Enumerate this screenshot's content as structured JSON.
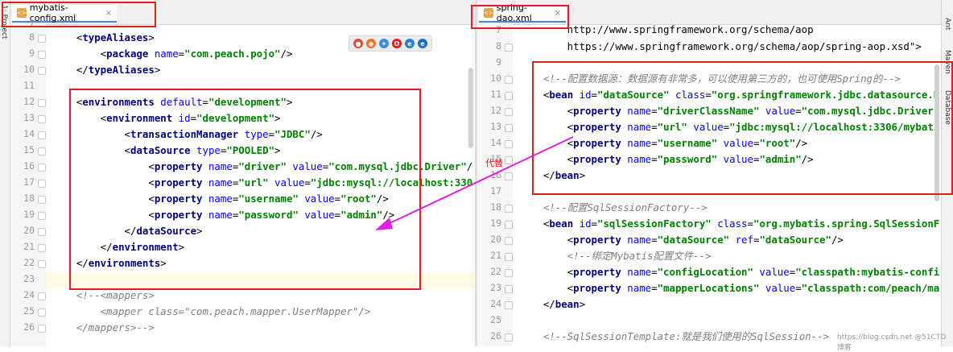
{
  "left_panel": {
    "label": "1: Project"
  },
  "right_panel": {
    "labels": [
      "Ant",
      "Maven",
      "Database"
    ]
  },
  "left_editor": {
    "tab": {
      "label": "mybatis-config.xml",
      "close": "×"
    },
    "first_line": "7",
    "lines": [
      {
        "n": "8",
        "segs": [
          {
            "k": "p",
            "x": "    <"
          },
          {
            "k": "t",
            "x": "typeAliases"
          },
          {
            "k": "p",
            "x": ">"
          }
        ]
      },
      {
        "n": "9",
        "segs": [
          {
            "k": "p",
            "x": "        <"
          },
          {
            "k": "t",
            "x": "package "
          },
          {
            "k": "a",
            "x": "name"
          },
          {
            "k": "p",
            "x": "="
          },
          {
            "k": "v",
            "x": "\"com.peach.pojo\""
          },
          {
            "k": "p",
            "x": "/>"
          }
        ]
      },
      {
        "n": "10",
        "segs": [
          {
            "k": "p",
            "x": "    </"
          },
          {
            "k": "t",
            "x": "typeAliases"
          },
          {
            "k": "p",
            "x": ">"
          }
        ]
      },
      {
        "n": "11",
        "segs": []
      },
      {
        "n": "12",
        "segs": [
          {
            "k": "p",
            "x": "    <"
          },
          {
            "k": "t",
            "x": "environments "
          },
          {
            "k": "a",
            "x": "default"
          },
          {
            "k": "p",
            "x": "="
          },
          {
            "k": "v",
            "x": "\"development\""
          },
          {
            "k": "p",
            "x": ">"
          }
        ]
      },
      {
        "n": "13",
        "segs": [
          {
            "k": "p",
            "x": "        <"
          },
          {
            "k": "t",
            "x": "environment "
          },
          {
            "k": "a",
            "x": "id"
          },
          {
            "k": "p",
            "x": "="
          },
          {
            "k": "v",
            "x": "\"development\""
          },
          {
            "k": "p",
            "x": ">"
          }
        ]
      },
      {
        "n": "14",
        "segs": [
          {
            "k": "p",
            "x": "            <"
          },
          {
            "k": "t",
            "x": "transactionManager "
          },
          {
            "k": "a",
            "x": "type"
          },
          {
            "k": "p",
            "x": "="
          },
          {
            "k": "v",
            "x": "\"JDBC\""
          },
          {
            "k": "p",
            "x": "/>"
          }
        ]
      },
      {
        "n": "15",
        "segs": [
          {
            "k": "p",
            "x": "            <"
          },
          {
            "k": "t",
            "x": "dataSource "
          },
          {
            "k": "a",
            "x": "type"
          },
          {
            "k": "p",
            "x": "="
          },
          {
            "k": "v",
            "x": "\"POOLED\""
          },
          {
            "k": "p",
            "x": ">"
          }
        ]
      },
      {
        "n": "16",
        "segs": [
          {
            "k": "p",
            "x": "                <"
          },
          {
            "k": "t",
            "x": "property "
          },
          {
            "k": "a",
            "x": "name"
          },
          {
            "k": "p",
            "x": "="
          },
          {
            "k": "v",
            "x": "\"driver\" "
          },
          {
            "k": "a",
            "x": "value"
          },
          {
            "k": "p",
            "x": "="
          },
          {
            "k": "v",
            "x": "\"com.mysql.jdbc.Driver\""
          },
          {
            "k": "p",
            "x": "/"
          }
        ]
      },
      {
        "n": "17",
        "segs": [
          {
            "k": "p",
            "x": "                <"
          },
          {
            "k": "t",
            "x": "property "
          },
          {
            "k": "a",
            "x": "name"
          },
          {
            "k": "p",
            "x": "="
          },
          {
            "k": "v",
            "x": "\"url\" "
          },
          {
            "k": "a",
            "x": "value"
          },
          {
            "k": "p",
            "x": "="
          },
          {
            "k": "v",
            "x": "\"jdbc:mysql://localhost:330"
          }
        ]
      },
      {
        "n": "18",
        "segs": [
          {
            "k": "p",
            "x": "                <"
          },
          {
            "k": "t",
            "x": "property "
          },
          {
            "k": "a",
            "x": "name"
          },
          {
            "k": "p",
            "x": "="
          },
          {
            "k": "v",
            "x": "\"username\" "
          },
          {
            "k": "a",
            "x": "value"
          },
          {
            "k": "p",
            "x": "="
          },
          {
            "k": "v",
            "x": "\"root\""
          },
          {
            "k": "p",
            "x": "/>"
          }
        ]
      },
      {
        "n": "19",
        "segs": [
          {
            "k": "p",
            "x": "                <"
          },
          {
            "k": "t",
            "x": "property "
          },
          {
            "k": "a",
            "x": "name"
          },
          {
            "k": "p",
            "x": "="
          },
          {
            "k": "v",
            "x": "\"password\" "
          },
          {
            "k": "a",
            "x": "value"
          },
          {
            "k": "p",
            "x": "="
          },
          {
            "k": "v",
            "x": "\"admin\""
          },
          {
            "k": "p",
            "x": "/>"
          }
        ]
      },
      {
        "n": "20",
        "segs": [
          {
            "k": "p",
            "x": "            </"
          },
          {
            "k": "t",
            "x": "dataSource"
          },
          {
            "k": "p",
            "x": ">"
          }
        ]
      },
      {
        "n": "21",
        "segs": [
          {
            "k": "p",
            "x": "        </"
          },
          {
            "k": "t",
            "x": "environment"
          },
          {
            "k": "p",
            "x": ">"
          }
        ]
      },
      {
        "n": "22",
        "segs": [
          {
            "k": "p",
            "x": "    </"
          },
          {
            "k": "t",
            "x": "environments"
          },
          {
            "k": "p",
            "x": ">"
          }
        ]
      },
      {
        "n": "23",
        "segs": []
      },
      {
        "n": "24",
        "segs": [
          {
            "k": "c",
            "x": "    <!--<mappers>"
          }
        ]
      },
      {
        "n": "25",
        "segs": [
          {
            "k": "c",
            "x": "        <mapper class=\"com.peach.mapper.UserMapper\"/>"
          }
        ]
      },
      {
        "n": "26",
        "segs": [
          {
            "k": "c",
            "x": "    </mappers>-->"
          }
        ]
      }
    ]
  },
  "right_editor": {
    "tab": {
      "label": "spring-dao.xml",
      "close": "×"
    },
    "first_line": "7",
    "lines": [
      {
        "n": "8",
        "segs": [
          {
            "k": "u",
            "x": "        https://www.springframework.org/schema/aop/spring-aop.xsd\">"
          }
        ]
      },
      {
        "n": "9",
        "segs": []
      },
      {
        "n": "10",
        "segs": [
          {
            "k": "c",
            "x": "    <!--配置数据源：数据源有非常多，可以使用第三方的，也可使用Spring的-->"
          }
        ]
      },
      {
        "n": "11",
        "segs": [
          {
            "k": "p",
            "x": "    <"
          },
          {
            "k": "t",
            "x": "bean "
          },
          {
            "k": "a",
            "x": "id"
          },
          {
            "k": "p",
            "x": "="
          },
          {
            "k": "v",
            "x": "\"dataSource\" "
          },
          {
            "k": "a",
            "x": "class"
          },
          {
            "k": "p",
            "x": "="
          },
          {
            "k": "v",
            "x": "\"org.springframework.jdbc.datasource.D"
          }
        ]
      },
      {
        "n": "12",
        "segs": [
          {
            "k": "p",
            "x": "        <"
          },
          {
            "k": "t",
            "x": "property "
          },
          {
            "k": "a",
            "x": "name"
          },
          {
            "k": "p",
            "x": "="
          },
          {
            "k": "v",
            "x": "\"driverClassName\" "
          },
          {
            "k": "a",
            "x": "value"
          },
          {
            "k": "p",
            "x": "="
          },
          {
            "k": "v",
            "x": "\"com.mysql.jdbc.Driver"
          }
        ]
      },
      {
        "n": "13",
        "segs": [
          {
            "k": "p",
            "x": "        <"
          },
          {
            "k": "t",
            "x": "property "
          },
          {
            "k": "a",
            "x": "name"
          },
          {
            "k": "p",
            "x": "="
          },
          {
            "k": "v",
            "x": "\"url\" "
          },
          {
            "k": "a",
            "x": "value"
          },
          {
            "k": "p",
            "x": "="
          },
          {
            "k": "v",
            "x": "\"jdbc:mysql://localhost:3306/mybati"
          }
        ]
      },
      {
        "n": "14",
        "segs": [
          {
            "k": "p",
            "x": "        <"
          },
          {
            "k": "t",
            "x": "property "
          },
          {
            "k": "a",
            "x": "name"
          },
          {
            "k": "p",
            "x": "="
          },
          {
            "k": "v",
            "x": "\"username\" "
          },
          {
            "k": "a",
            "x": "value"
          },
          {
            "k": "p",
            "x": "="
          },
          {
            "k": "v",
            "x": "\"root\""
          },
          {
            "k": "p",
            "x": "/>"
          }
        ]
      },
      {
        "n": "15",
        "segs": [
          {
            "k": "p",
            "x": "        <"
          },
          {
            "k": "t",
            "x": "property "
          },
          {
            "k": "a",
            "x": "name"
          },
          {
            "k": "p",
            "x": "="
          },
          {
            "k": "v",
            "x": "\"password\" "
          },
          {
            "k": "a",
            "x": "value"
          },
          {
            "k": "p",
            "x": "="
          },
          {
            "k": "v",
            "x": "\"admin\""
          },
          {
            "k": "p",
            "x": "/>"
          }
        ]
      },
      {
        "n": "16",
        "segs": [
          {
            "k": "p",
            "x": "    </"
          },
          {
            "k": "t",
            "x": "bean"
          },
          {
            "k": "p",
            "x": ">"
          }
        ]
      },
      {
        "n": "17",
        "segs": []
      },
      {
        "n": "18",
        "segs": [
          {
            "k": "c",
            "x": "    <!--配置SqlSessionFactory-->"
          }
        ]
      },
      {
        "n": "19",
        "segs": [
          {
            "k": "p",
            "x": "    <"
          },
          {
            "k": "t",
            "x": "bean "
          },
          {
            "k": "a",
            "x": "id"
          },
          {
            "k": "p",
            "x": "="
          },
          {
            "k": "v",
            "x": "\"sqlSessionFactory\" "
          },
          {
            "k": "a",
            "x": "class"
          },
          {
            "k": "p",
            "x": "="
          },
          {
            "k": "v",
            "x": "\"org.mybatis.spring.SqlSessionF"
          }
        ]
      },
      {
        "n": "20",
        "segs": [
          {
            "k": "p",
            "x": "        <"
          },
          {
            "k": "t",
            "x": "property "
          },
          {
            "k": "a",
            "x": "name"
          },
          {
            "k": "p",
            "x": "="
          },
          {
            "k": "v",
            "x": "\"dataSource\" "
          },
          {
            "k": "a",
            "x": "ref"
          },
          {
            "k": "p",
            "x": "="
          },
          {
            "k": "v",
            "x": "\"dataSource\""
          },
          {
            "k": "p",
            "x": "/>"
          }
        ]
      },
      {
        "n": "21",
        "segs": [
          {
            "k": "c",
            "x": "        <!--绑定Mybatis配置文件-->"
          }
        ]
      },
      {
        "n": "22",
        "segs": [
          {
            "k": "p",
            "x": "        <"
          },
          {
            "k": "t",
            "x": "property "
          },
          {
            "k": "a",
            "x": "name"
          },
          {
            "k": "p",
            "x": "="
          },
          {
            "k": "v",
            "x": "\"configLocation\" "
          },
          {
            "k": "a",
            "x": "value"
          },
          {
            "k": "p",
            "x": "="
          },
          {
            "k": "v",
            "x": "\"classpath:mybatis-confi"
          }
        ]
      },
      {
        "n": "23",
        "segs": [
          {
            "k": "p",
            "x": "        <"
          },
          {
            "k": "t",
            "x": "property "
          },
          {
            "k": "a",
            "x": "name"
          },
          {
            "k": "p",
            "x": "="
          },
          {
            "k": "v",
            "x": "\"mapperLocations\" "
          },
          {
            "k": "a",
            "x": "value"
          },
          {
            "k": "p",
            "x": "="
          },
          {
            "k": "v",
            "x": "\"classpath:com/peach/ma"
          }
        ]
      },
      {
        "n": "24",
        "segs": [
          {
            "k": "p",
            "x": "    </"
          },
          {
            "k": "t",
            "x": "bean"
          },
          {
            "k": "p",
            "x": ">"
          }
        ]
      },
      {
        "n": "25",
        "segs": []
      },
      {
        "n": "26",
        "segs": [
          {
            "k": "c",
            "x": "    <!--SqlSessionTemplate:就是我们使用的SqlSession-->"
          }
        ]
      }
    ],
    "top_line": "        http://www.springframework.org/schema/aop"
  },
  "annotation": {
    "label": "代替",
    "arrow_color": "#e020e0"
  },
  "browser_icons": [
    "chrome-icon",
    "firefox-icon",
    "safari-icon",
    "opera-icon",
    "ie-icon",
    "edge-icon"
  ],
  "watermark": "https://blog.csdn.net  @51CTO博客",
  "colors": {
    "tag": "#000080",
    "attr": "#0000ff",
    "value": "#008000",
    "comment": "#808080",
    "box": "#e0201c"
  }
}
